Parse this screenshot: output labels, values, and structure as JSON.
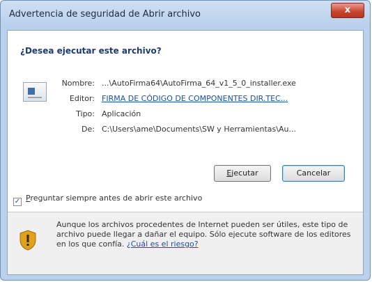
{
  "window": {
    "title": "Advertencia de seguridad de Abrir archivo",
    "close_label": "x"
  },
  "dialog": {
    "heading": "¿Desea ejecutar este archivo?",
    "fields": [
      {
        "label": "Nombre:",
        "value": "...\\AutoFirma64\\AutoFirma_64_v1_5_0_installer.exe"
      },
      {
        "label": "Editor:",
        "value": "FIRMA DE CÓDIGO DE COMPONENTES DIR.TEC..."
      },
      {
        "label": "Tipo:",
        "value": "Aplicación"
      },
      {
        "label": "De:",
        "value": "C:\\Users\\ame\\Documents\\SW y Herramientas\\Au..."
      }
    ],
    "run_button": {
      "accel": "E",
      "rest": "jecutar"
    },
    "cancel_button": "Cancelar",
    "checkbox": {
      "checked": true,
      "accel": "P",
      "label_rest": "reguntar siempre antes de abrir este archivo"
    },
    "warning": {
      "text": "Aunque los archivos procedentes de Internet pueden ser útiles, este tipo de archivo puede llegar a dañar el equipo. Sólo ejecute software de los editores en los que confía.",
      "link": "¿Cuál es el riesgo?"
    }
  },
  "icons": {
    "file": "application-file-icon",
    "warning": "security-shield-warning-icon"
  },
  "colors": {
    "accent": "#1c3b78",
    "link": "#1a4ea8",
    "close": "#c7432d"
  }
}
